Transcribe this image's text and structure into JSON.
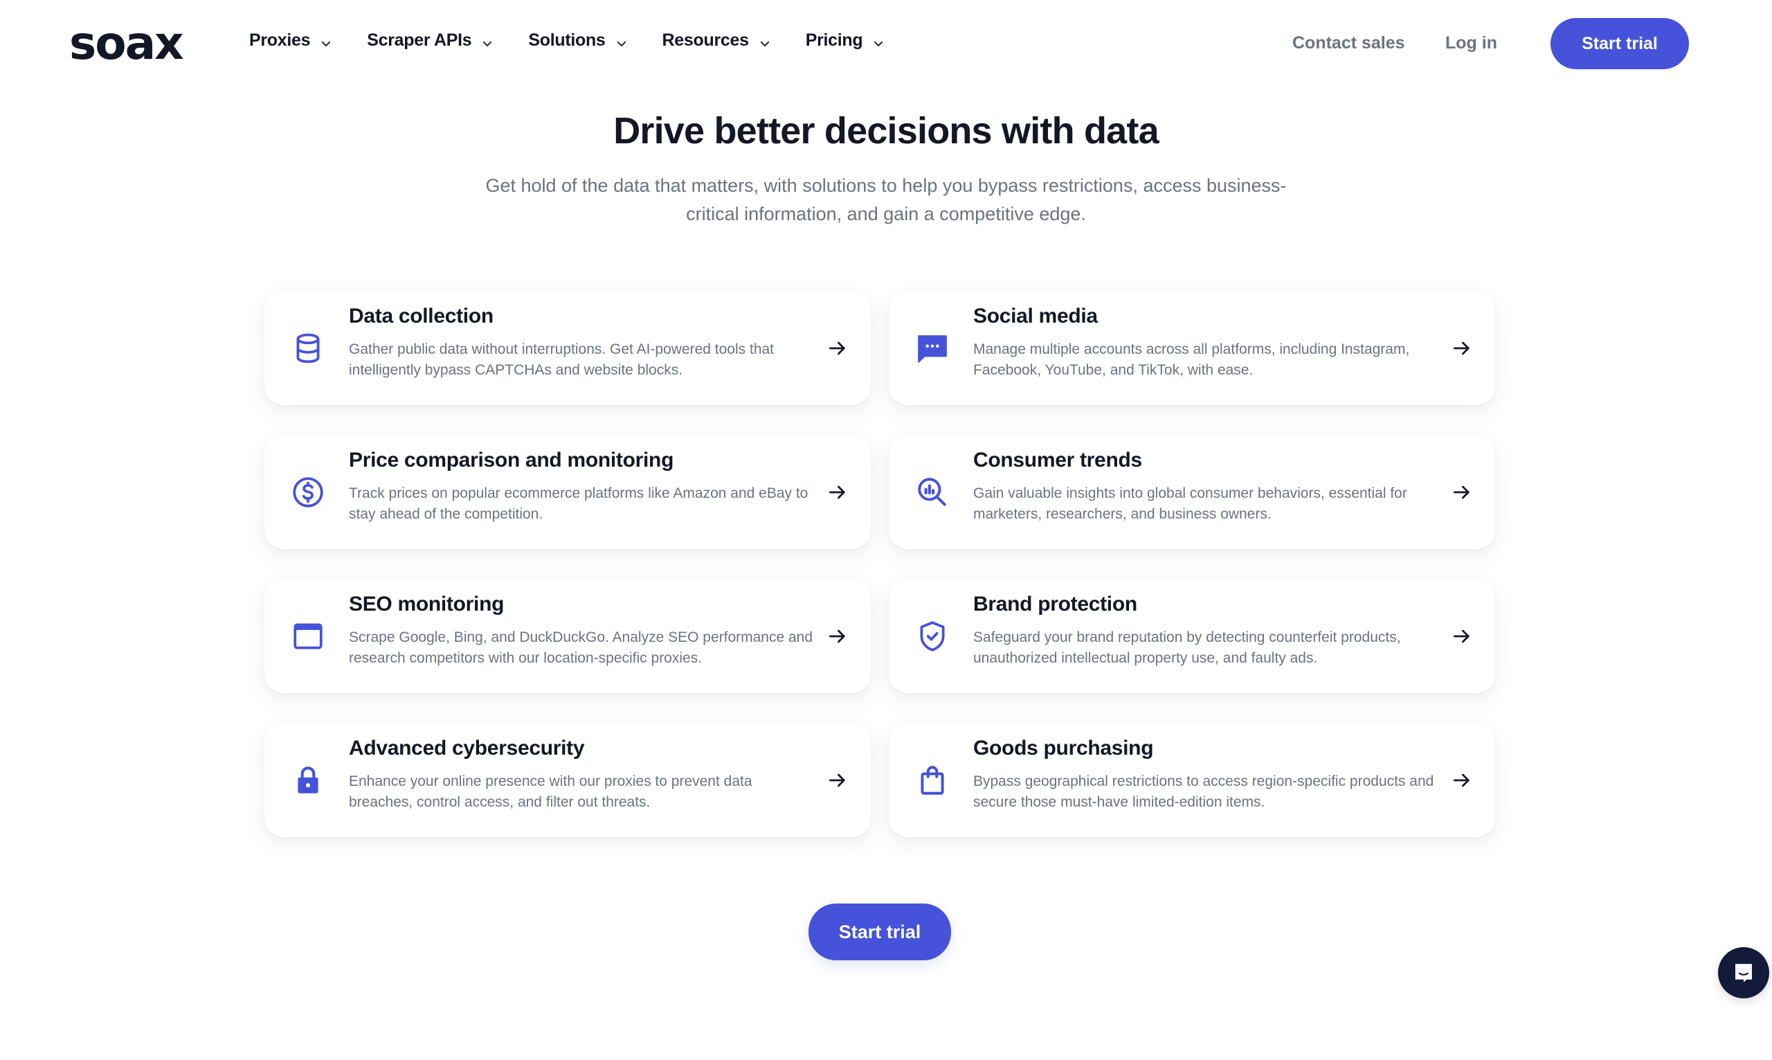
{
  "header": {
    "logo": "soax",
    "nav": [
      {
        "label": "Proxies"
      },
      {
        "label": "Scraper APIs"
      },
      {
        "label": "Solutions"
      },
      {
        "label": "Resources"
      },
      {
        "label": "Pricing"
      }
    ],
    "contact_sales": "Contact sales",
    "login": "Log in",
    "start_trial": "Start trial"
  },
  "hero": {
    "title": "Drive better decisions with data",
    "subtitle": "Get hold of the data that matters, with solutions to help you bypass restrictions, access business-critical information, and gain a competitive edge."
  },
  "cards": [
    {
      "icon": "database-icon",
      "title": "Data collection",
      "description": "Gather public data without interruptions. Get AI-powered tools that intelligently bypass CAPTCHAs and website blocks."
    },
    {
      "icon": "chat-icon",
      "title": "Social media",
      "description": "Manage multiple accounts across all platforms, including Instagram, Facebook, YouTube, and TikTok, with ease."
    },
    {
      "icon": "dollar-circle-icon",
      "title": "Price comparison and monitoring",
      "description": "Track prices on popular ecommerce platforms like Amazon and eBay to stay ahead of the competition."
    },
    {
      "icon": "search-chart-icon",
      "title": "Consumer trends",
      "description": "Gain valuable insights into global consumer behaviors, essential for marketers, researchers, and business owners."
    },
    {
      "icon": "browser-window-icon",
      "title": "SEO monitoring",
      "description": "Scrape Google, Bing, and DuckDuckGo. Analyze SEO performance and research competitors with our location-specific proxies."
    },
    {
      "icon": "shield-check-icon",
      "title": "Brand protection",
      "description": "Safeguard your brand reputation by detecting counterfeit products, unauthorized intellectual property use, and faulty ads."
    },
    {
      "icon": "lock-icon",
      "title": "Advanced cybersecurity",
      "description": "Enhance your online presence with our proxies to prevent data breaches, control access, and filter out threats."
    },
    {
      "icon": "shopping-bag-icon",
      "title": "Goods purchasing",
      "description": "Bypass geographical restrictions to access region-specific products and secure those must-have limited-edition items."
    }
  ],
  "cta": {
    "start_trial": "Start trial"
  },
  "colors": {
    "accent": "#4552d9",
    "text_dark": "#131726",
    "text_muted": "#6b7280",
    "chat_bg": "#131a3a"
  }
}
